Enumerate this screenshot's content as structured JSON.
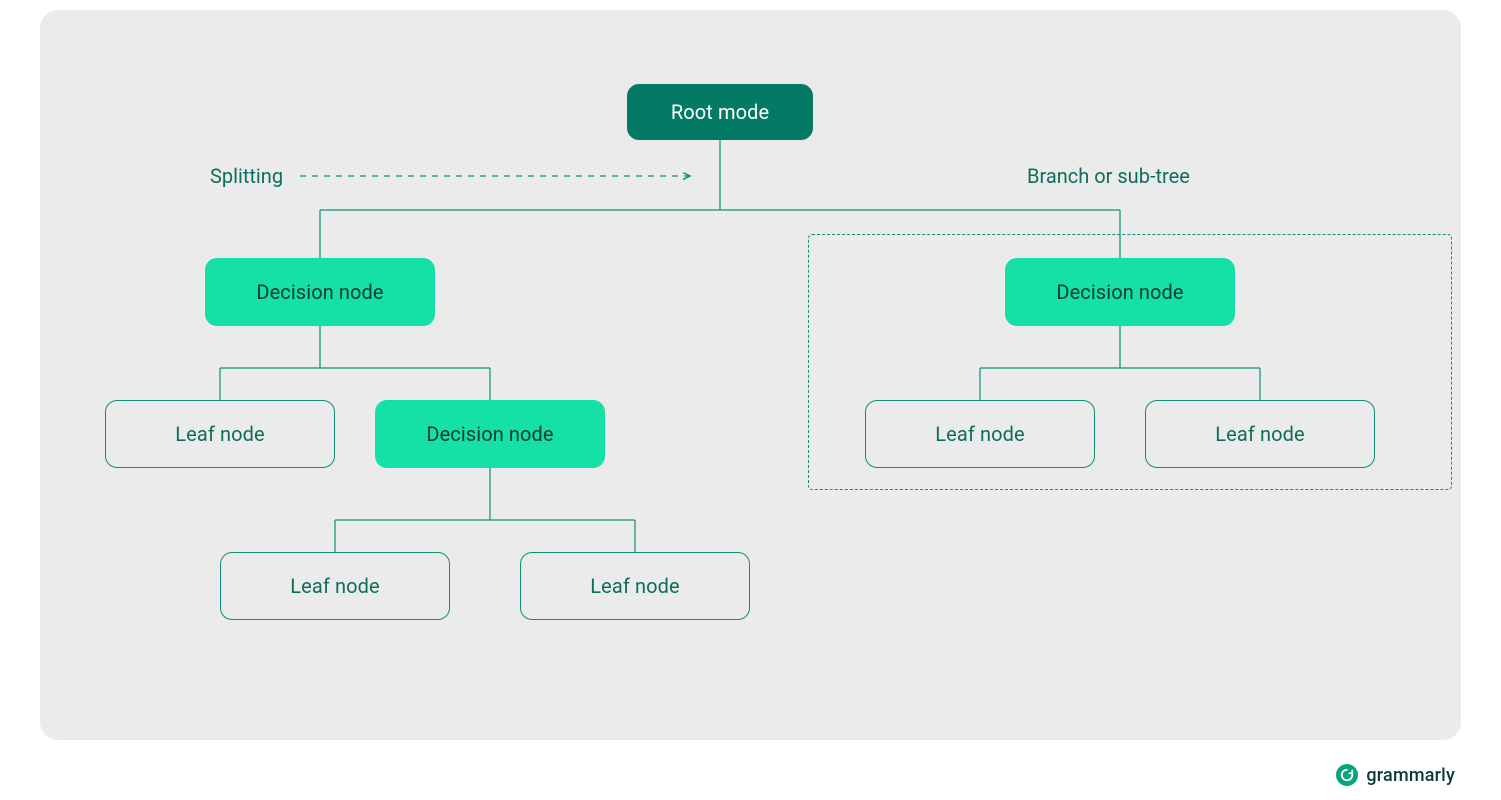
{
  "diagram": {
    "root": {
      "label": "Root mode"
    },
    "labels": {
      "splitting": "Splitting",
      "branch": "Branch or sub-tree"
    },
    "left": {
      "decision": "Decision node",
      "leaf1": "Leaf node",
      "sub_decision": "Decision node",
      "sub_leaf1": "Leaf node",
      "sub_leaf2": "Leaf node"
    },
    "right": {
      "decision": "Decision node",
      "leaf1": "Leaf node",
      "leaf2": "Leaf node"
    }
  },
  "brand": {
    "name": "grammarly"
  },
  "colors": {
    "bg": "#ebebeb",
    "root_fill": "#027a64",
    "decision_fill": "#15e0a5",
    "line": "#0e8f77",
    "text_dark": "#0b3b36"
  }
}
